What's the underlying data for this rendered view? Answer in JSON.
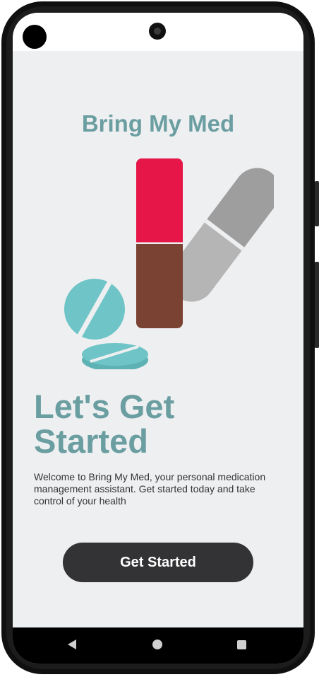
{
  "app": {
    "title": "Bring My Med"
  },
  "onboarding": {
    "headline_line1": "Let's Get",
    "headline_line2": "Started",
    "description": "Welcome to Bring My Med, your personal medication management assistant. Get started today and take control of your health",
    "cta_label": "Get Started"
  },
  "illustration": {
    "icon": "medication-pills-illustration",
    "colors": {
      "capsule_top": "#e8164a",
      "capsule_bottom": "#7b4030",
      "capsule_gray_dark": "#999999",
      "capsule_gray_light": "#b8b8b8",
      "tablet_teal": "#6ec4c6"
    }
  },
  "theme": {
    "accent": "#6a9ea1",
    "button_bg": "#333335",
    "background": "#eeeff1"
  },
  "navigation": {
    "back_icon": "back-triangle-icon",
    "home_icon": "home-circle-icon",
    "recents_icon": "recents-square-icon"
  }
}
